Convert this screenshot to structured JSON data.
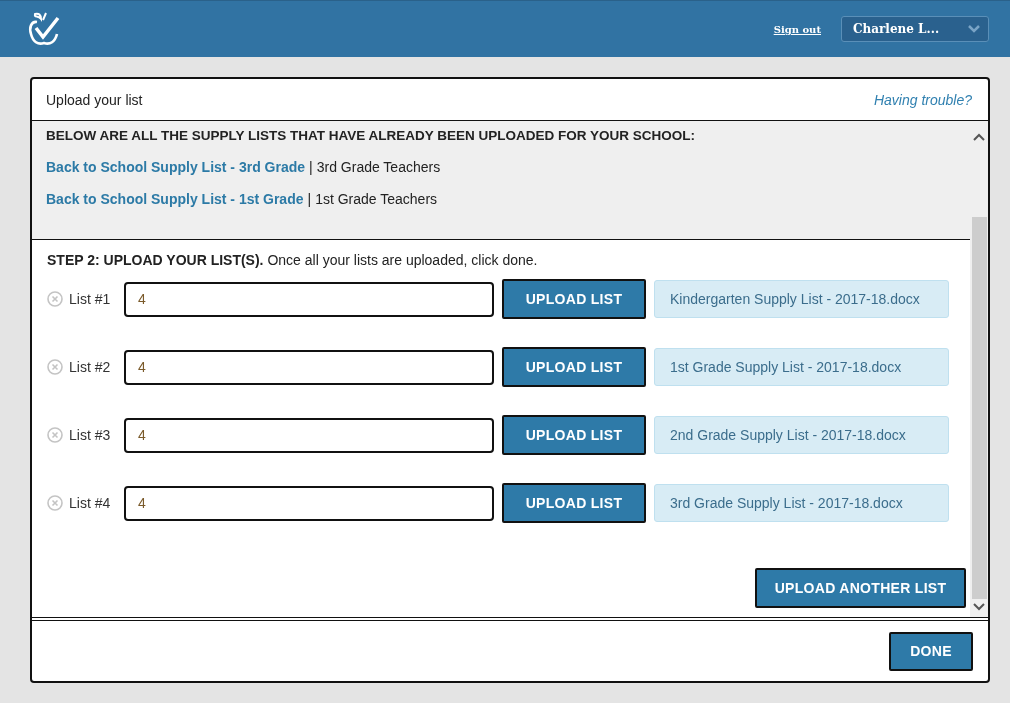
{
  "header": {
    "sign_out": "Sign out",
    "user_menu": "Charlene L..."
  },
  "dialog": {
    "title": "Upload your list",
    "help_link": "Having trouble?"
  },
  "uploaded": {
    "heading": "BELOW ARE ALL THE SUPPLY LISTS THAT HAVE ALREADY BEEN UPLOADED FOR YOUR SCHOOL:",
    "items": [
      {
        "link": "Back to School Supply List - 3rd Grade",
        "separator": "|",
        "audience": "3rd Grade Teachers"
      },
      {
        "link": "Back to School Supply List - 1st Grade",
        "separator": "|",
        "audience": "1st Grade Teachers"
      }
    ]
  },
  "step": {
    "text": "**STEP 2: UPLOAD YOUR LIST(S).** Once all your lists are uploaded, click done."
  },
  "lists": [
    {
      "label": "List #1",
      "value": "4",
      "button": "UPLOAD LIST",
      "file": "Kindergarten Supply List - 2017-18.docx"
    },
    {
      "label": "List #2",
      "value": "4",
      "button": "UPLOAD LIST",
      "file": "1st Grade Supply List - 2017-18.docx"
    },
    {
      "label": "List #3",
      "value": "4",
      "button": "UPLOAD LIST",
      "file": "2nd Grade Supply List - 2017-18.docx"
    },
    {
      "label": "List #4",
      "value": "4",
      "button": "UPLOAD LIST",
      "file": "3rd Grade Supply List - 2017-18.docx"
    }
  ],
  "add_button": "UPLOAD ANOTHER LIST",
  "done_button": "DONE"
}
